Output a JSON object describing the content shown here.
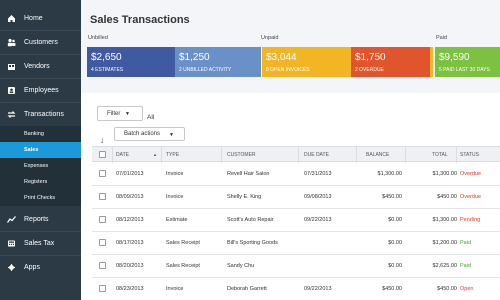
{
  "sidebar": {
    "items": [
      {
        "label": "Home",
        "icon": "home-icon"
      },
      {
        "label": "Customers",
        "icon": "customers-icon"
      },
      {
        "label": "Vendors",
        "icon": "vendors-icon"
      },
      {
        "label": "Employees",
        "icon": "employees-icon"
      },
      {
        "label": "Transactions",
        "icon": "transactions-icon"
      },
      {
        "label": "Reports",
        "icon": "reports-icon"
      },
      {
        "label": "Sales Tax",
        "icon": "sales-tax-icon"
      },
      {
        "label": "Apps",
        "icon": "apps-icon"
      }
    ],
    "sub_items": [
      {
        "label": "Banking"
      },
      {
        "label": "Sales"
      },
      {
        "label": "Expenses"
      },
      {
        "label": "Registers"
      },
      {
        "label": "Print Checks"
      }
    ],
    "active_sub_item": "Sales"
  },
  "page": {
    "title": "Sales Transactions"
  },
  "summary": {
    "unbilled_label": "Unbilled",
    "unpaid_label": "Unpaid",
    "paid_label": "Paid",
    "cards": [
      {
        "amount": "$2,650",
        "caption": "4 ESTIMATES",
        "color": "#3f5aa0"
      },
      {
        "amount": "$1,250",
        "caption": "2 UNBILLED ACTIVITY",
        "color": "#6a90c8"
      },
      {
        "amount": "$3,044",
        "caption": "8 OPEN INVOICES",
        "color": "#f2b526"
      },
      {
        "amount": "$1,750",
        "caption": "2 OVERDUE",
        "color": "#e0552b"
      },
      {
        "amount": "$9,590",
        "caption": "5 PAID LAST 30 DAYS",
        "color": "#7cc140"
      }
    ]
  },
  "toolbar": {
    "filter_label": "Filter",
    "all_label": "All",
    "batch_actions_label": "Batch actions"
  },
  "table": {
    "columns": [
      "DATE",
      "TYPE",
      "CUSTOMER",
      "DUE DATE",
      "BALANCE",
      "TOTAL",
      "STATUS"
    ],
    "rows": [
      {
        "date": "07/01/2013",
        "type": "Invoice",
        "customer": "Revell Hair Salon",
        "due": "07/31/2013",
        "balance": "$1,300.00",
        "total": "$1,300.00",
        "status": "Overdue",
        "status_color": "#e0382b"
      },
      {
        "date": "08/09/2013",
        "type": "Invoice",
        "customer": "Shelly E. King",
        "due": "09/08/2013",
        "balance": "$450.00",
        "total": "$450.00",
        "status": "Overdue",
        "status_color": "#e0382b"
      },
      {
        "date": "08/12/2013",
        "type": "Estimate",
        "customer": "Scott's Auto Repair",
        "due": "09/22/2013",
        "balance": "$0.00",
        "total": "$1,300.00",
        "status": "Pending",
        "status_color": "#e0382b"
      },
      {
        "date": "08/17/2013",
        "type": "Sales Receipt",
        "customer": "Bill's Sporting Goods",
        "due": "",
        "balance": "$0.00",
        "total": "$1,200.00",
        "status": "Paid",
        "status_color": "#43a33a"
      },
      {
        "date": "08/20/2013",
        "type": "Sales Receipt",
        "customer": "Sandy Chu",
        "due": "",
        "balance": "$0.00",
        "total": "$2,625.00",
        "status": "Paid",
        "status_color": "#43a33a"
      },
      {
        "date": "08/23/2013",
        "type": "Invoice",
        "customer": "Deborah Garrett",
        "due": "09/22/2013",
        "balance": "$450.00",
        "total": "$450.00",
        "status": "Open",
        "status_color": "#e0382b"
      }
    ]
  }
}
